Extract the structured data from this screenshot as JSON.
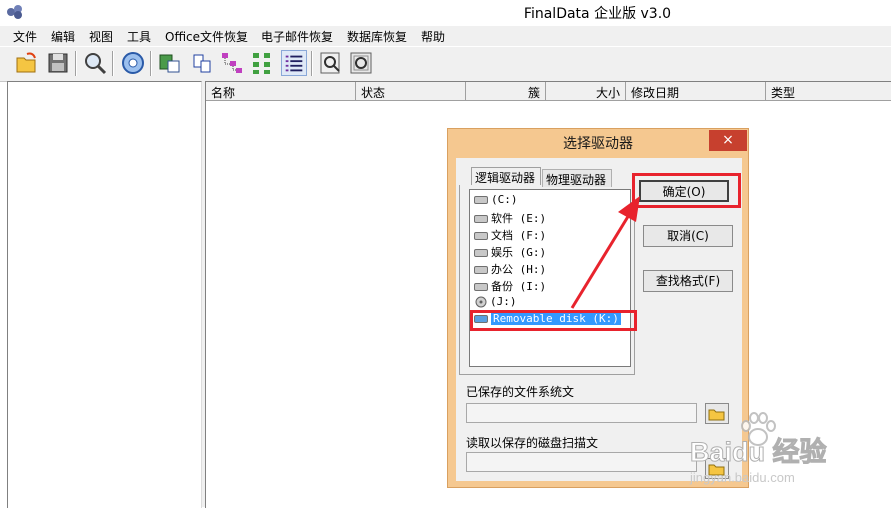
{
  "app": {
    "title": "FinalData 企业版 v3.0"
  },
  "menu": [
    "文件",
    "编辑",
    "视图",
    "工具",
    "Office文件恢复",
    "电子邮件恢复",
    "数据库恢复",
    "帮助"
  ],
  "toolbar": [
    "open-icon",
    "save-icon",
    "search-icon",
    "scan-icon",
    "recover-icon",
    "copy-icon",
    "tree-icon",
    "tree-expand-icon",
    "details-icon",
    "find-icon",
    "preview-icon"
  ],
  "columns": [
    "名称",
    "状态",
    "簇",
    "大小",
    "修改日期",
    "类型"
  ],
  "dialog": {
    "title": "选择驱动器",
    "close": "×",
    "tabs": [
      "逻辑驱动器",
      "物理驱动器"
    ],
    "drives": [
      {
        "label": "(C:)"
      },
      {
        "label": "软件 (E:)"
      },
      {
        "label": "文档 (F:)"
      },
      {
        "label": "娱乐 (G:)"
      },
      {
        "label": "办公 (H:)"
      },
      {
        "label": "备份 (I:)"
      },
      {
        "label": "(J:)"
      },
      {
        "label": "Removable disk (K:)"
      }
    ],
    "ok": "确定(O)",
    "cancel": "取消(C)",
    "find_format": "查找格式(F)",
    "saved_fs_label": "已保存的文件系统文",
    "read_scan_label": "读取以保存的磁盘扫描文"
  },
  "watermark": {
    "brand": "Baidu 经验",
    "url": "jingyan.baidu.com"
  },
  "colors": {
    "annotation": "#e8232d",
    "dialog_frame": "#f5c890",
    "selection": "#3399ff"
  }
}
